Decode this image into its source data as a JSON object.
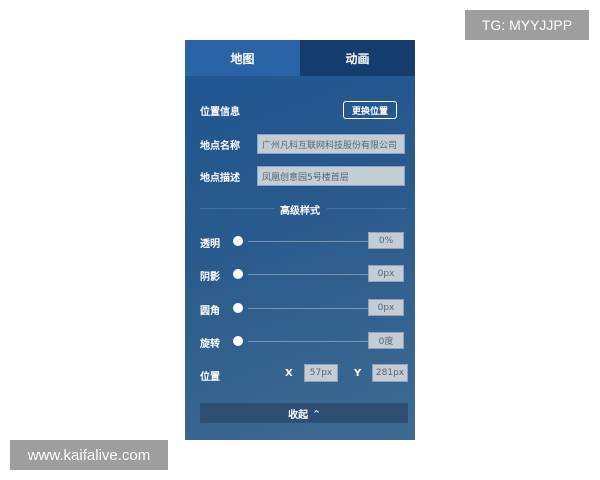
{
  "watermark": {
    "tg": "TG: MYYJJPP",
    "site": "www.kaifalive.com"
  },
  "tabs": [
    {
      "label": "地图",
      "active": true
    },
    {
      "label": "动画",
      "active": false
    }
  ],
  "location": {
    "label": "位置信息",
    "change_button": "更换位置",
    "name_label": "地点名称",
    "name_value": "广州凡科互联网科技股份有限公司",
    "desc_label": "地点描述",
    "desc_value": "凤凰创意园5号楼首层"
  },
  "advanced": {
    "title": "高级样式",
    "sliders": [
      {
        "label": "透明",
        "value": "0%"
      },
      {
        "label": "阴影",
        "value": "0px"
      },
      {
        "label": "圆角",
        "value": "0px"
      },
      {
        "label": "旋转",
        "value": "0度"
      }
    ],
    "position": {
      "label": "位置",
      "x_label": "X",
      "x_value": "57px",
      "y_label": "Y",
      "y_value": "281px"
    }
  },
  "collapse": {
    "label": "收起",
    "icon": "chevron-up-icon",
    "glyph": "^"
  },
  "colors": {
    "panel": "#2a5a8e",
    "active_tab": "#2a64a7",
    "inactive_tab": "#143d6e",
    "field": "#c4ccd6"
  }
}
